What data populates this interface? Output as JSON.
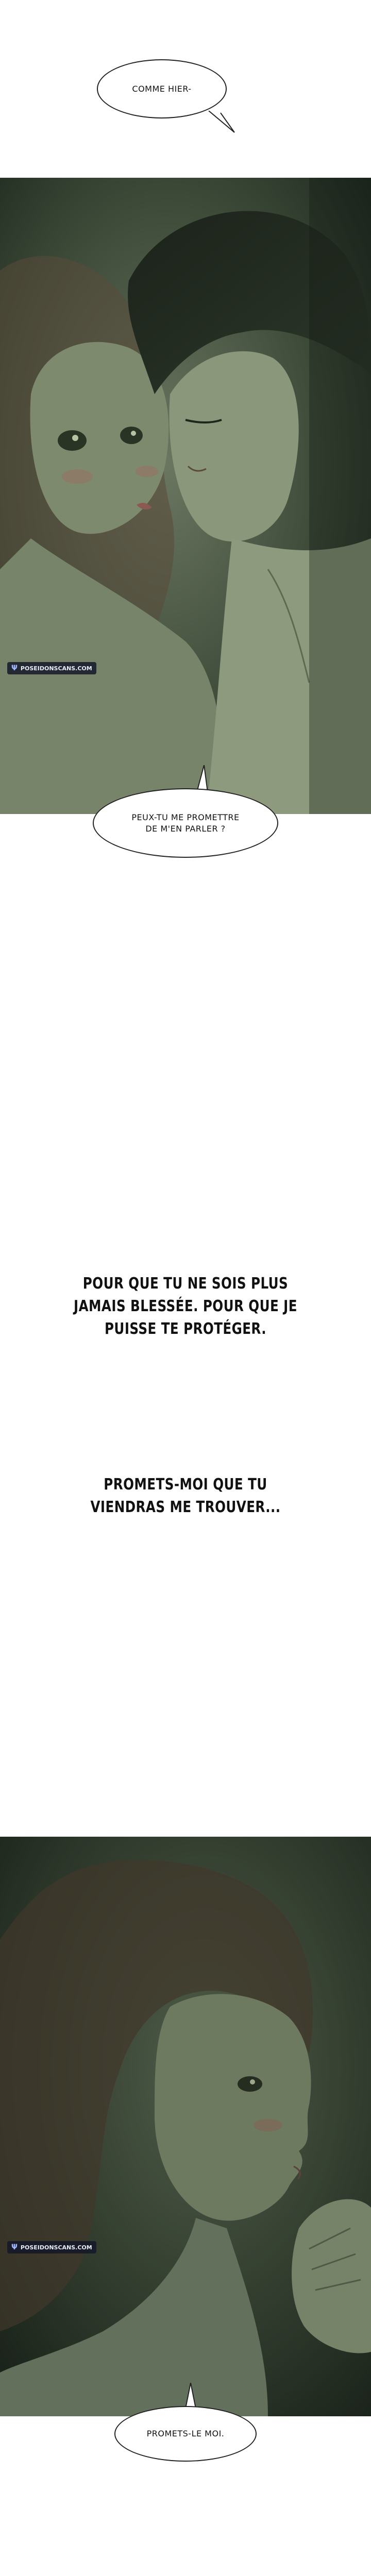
{
  "bubbles": {
    "b1": "COMME HIER-",
    "b2_line1": "PEUX-TU ME PROMETTRE",
    "b2_line2": "DE M'EN PARLER ?",
    "b3": "PROMETS-LE MOI."
  },
  "captions": {
    "c1_line1": "POUR QUE TU NE SOIS PLUS",
    "c1_line2": "JAMAIS BLESSÉE. POUR QUE JE",
    "c1_line3": "PUISSE TE PROTÉGER.",
    "c2_line1": "PROMETS-MOI QUE TU",
    "c2_line2": "VIENDRAS ME TROUVER..."
  },
  "watermark": {
    "text": "POSEIDONSCANS.COM",
    "icon": "trident-icon"
  },
  "colors": {
    "panel_dark": "#2e3a2c",
    "panel_mid": "#4a5a44",
    "skin_shadow": "#6d7a5e"
  }
}
